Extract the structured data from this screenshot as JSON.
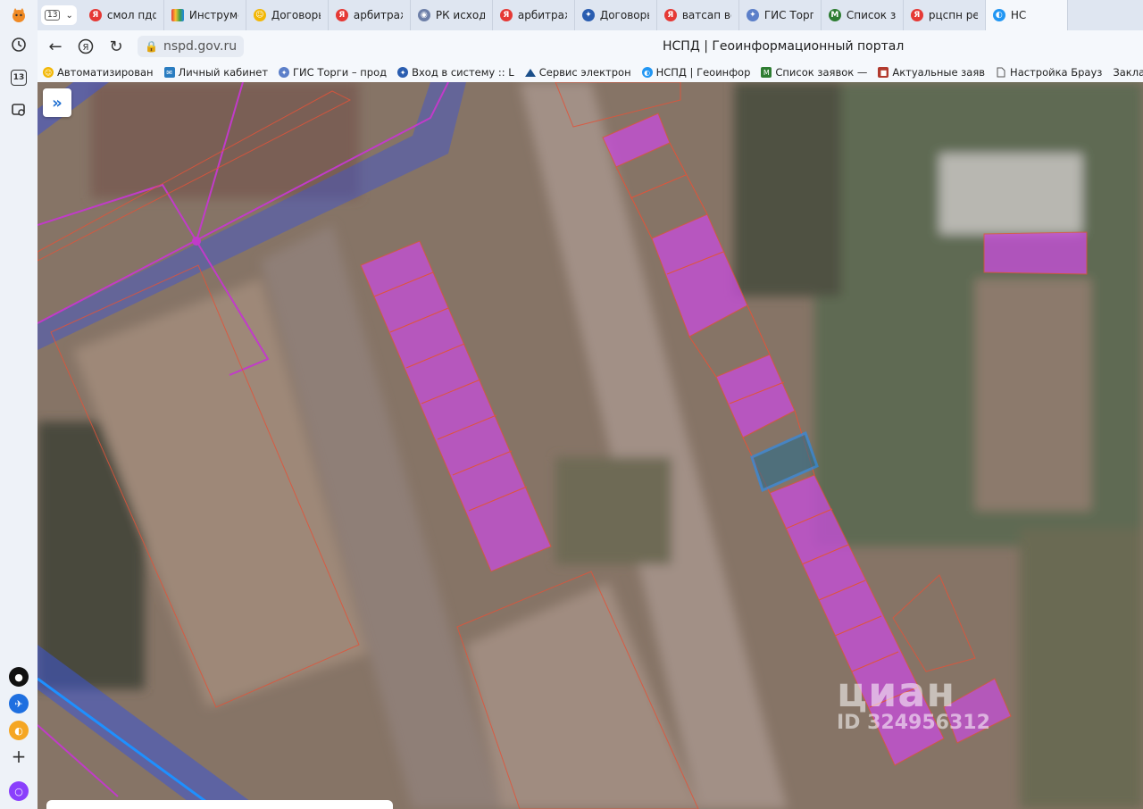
{
  "browser": {
    "tab_count": "13",
    "tabs": [
      {
        "title": "смол пдф с",
        "icon": "yandex-icon",
        "color": "#e53935"
      },
      {
        "title": "Инструмент",
        "icon": "grid-icon",
        "color": "#7e57c2"
      },
      {
        "title": "Договоры а",
        "icon": "smiley-icon",
        "color": "#f2b705"
      },
      {
        "title": "арбитражн",
        "icon": "yandex-icon",
        "color": "#e53935"
      },
      {
        "title": "РК исходящ",
        "icon": "chrome-icon",
        "color": "#6d7fa8"
      },
      {
        "title": "арбитражн",
        "icon": "yandex-icon",
        "color": "#e53935"
      },
      {
        "title": "Договоры :",
        "icon": "gov-eagle-icon",
        "color": "#2a5db0"
      },
      {
        "title": "ватсап веб",
        "icon": "yandex-icon",
        "color": "#e53935"
      },
      {
        "title": "ГИС Торги -",
        "icon": "gis-icon",
        "color": "#5b7fc9"
      },
      {
        "title": "Список зая",
        "icon": "gmail-icon",
        "color": "#2e7d32"
      },
      {
        "title": "рцспн респ",
        "icon": "yandex-icon",
        "color": "#e53935"
      },
      {
        "title": "НС",
        "icon": "nspd-icon",
        "color": "#2196f3",
        "active": true
      }
    ],
    "address": {
      "url": "nspd.gov.ru",
      "page_title": "НСПД | Геоинформационный портал"
    },
    "bookmarks": [
      {
        "title": "Автоматизирован",
        "icon": "smiley-icon",
        "color": "#f2b705"
      },
      {
        "title": "Личный кабинет",
        "icon": "mail-icon",
        "color": "#2a7dc1"
      },
      {
        "title": "ГИС Торги – прод",
        "icon": "gis-icon",
        "color": "#5b7fc9"
      },
      {
        "title": "Вход в систему :: L",
        "icon": "gov-eagle-icon",
        "color": "#2a5db0"
      },
      {
        "title": "Сервис электрон",
        "icon": "mountain-icon",
        "color": "#1b4f8a"
      },
      {
        "title": "НСПД | Геоинфор",
        "icon": "nspd-icon",
        "color": "#2196f3"
      },
      {
        "title": "Список заявок —",
        "icon": "gmail-icon",
        "color": "#2e7d32"
      },
      {
        "title": "Актуальные заяв",
        "icon": "cube-icon",
        "color": "#b23a2e"
      },
      {
        "title": "Настройка Брауз",
        "icon": "page-icon",
        "color": "#666666"
      },
      {
        "title": "Закладки Microsoft",
        "icon": "",
        "color": ""
      }
    ]
  },
  "sidebar": {
    "badge": "13",
    "items": [
      "history-icon",
      "tabs-badge-icon",
      "screenshot-icon"
    ],
    "apps": [
      "media-app-icon",
      "messenger-app-icon",
      "pay-app-icon",
      "add-icon",
      "alice-icon"
    ]
  },
  "map": {
    "expand_label": "»",
    "watermark_brand": "циан",
    "watermark_id": "ID 324956312",
    "parcel_fill": "#c44fd6",
    "selected_outline": "#1e90ff",
    "boundary_color": "#e0543a",
    "zone_color": "#3b5bd6"
  }
}
